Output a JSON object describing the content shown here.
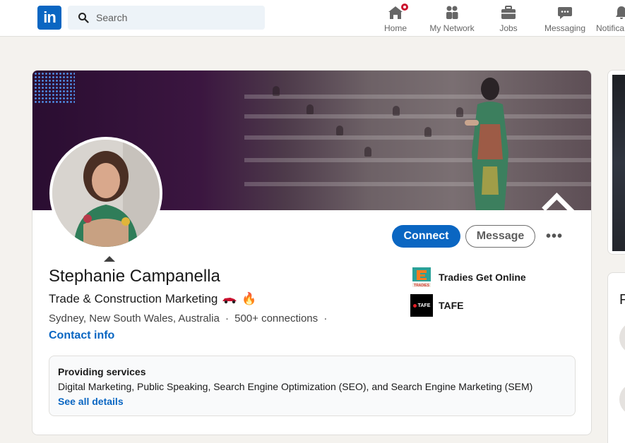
{
  "nav": {
    "search_placeholder": "Search",
    "items": [
      {
        "label": "Home",
        "icon": "home-icon",
        "badge": true
      },
      {
        "label": "My Network",
        "icon": "network-icon",
        "badge": false
      },
      {
        "label": "Jobs",
        "icon": "briefcase-icon",
        "badge": false
      },
      {
        "label": "Messaging",
        "icon": "messaging-icon",
        "badge": false
      },
      {
        "label": "Notifica",
        "icon": "bell-icon",
        "badge": true
      }
    ]
  },
  "profile": {
    "name": "Stephanie Campanella",
    "headline": "Trade & Construction Marketing",
    "headline_emoji": "🔥",
    "location": "Sydney, New South Wales, Australia",
    "separator": "·",
    "connections": "500+ connections",
    "contact_info": "Contact info",
    "actions": {
      "connect": "Connect",
      "message": "Message",
      "more": "•••"
    },
    "orgs": [
      {
        "name": "Tradies Get Online",
        "logo_text": "TRADIES"
      },
      {
        "name": "TAFE",
        "logo_text": "TAFE"
      }
    ],
    "services": {
      "title": "Providing services",
      "list": "Digital Marketing, Public Speaking, Search Engine Optimization (SEO), and Search Engine Marketing (SEM)",
      "link": "See all details"
    }
  },
  "side": {
    "letter": "P"
  },
  "colors": {
    "brand": "#0a66c2",
    "badge": "#cb112d"
  }
}
